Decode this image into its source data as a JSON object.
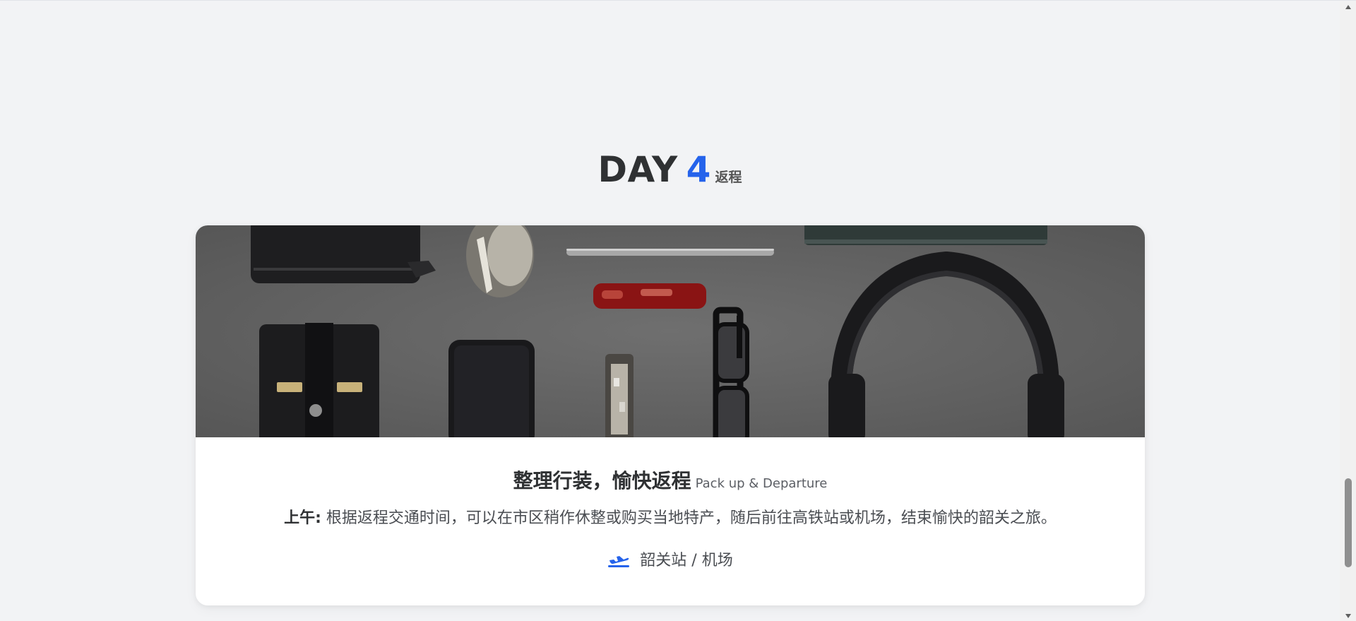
{
  "day": {
    "word": "DAY",
    "number": "4",
    "subtitle": "返程"
  },
  "card": {
    "image_description_icon": "travel-items-photo",
    "title_cn": "整理行装，愉快返程",
    "title_en": "Pack up & Departure",
    "desc_label": "上午:",
    "desc_text": " 根据返程交通时间，可以在市区稍作休整或购买当地特产，随后前往高铁站或机场，结束愉快的韶关之旅。",
    "location_icon": "plane-departure-icon",
    "location_text": "韶关站 / 机场"
  },
  "colors": {
    "accent": "#2563eb",
    "background": "#f2f3f5",
    "card": "#ffffff",
    "heading": "#2f3133"
  }
}
